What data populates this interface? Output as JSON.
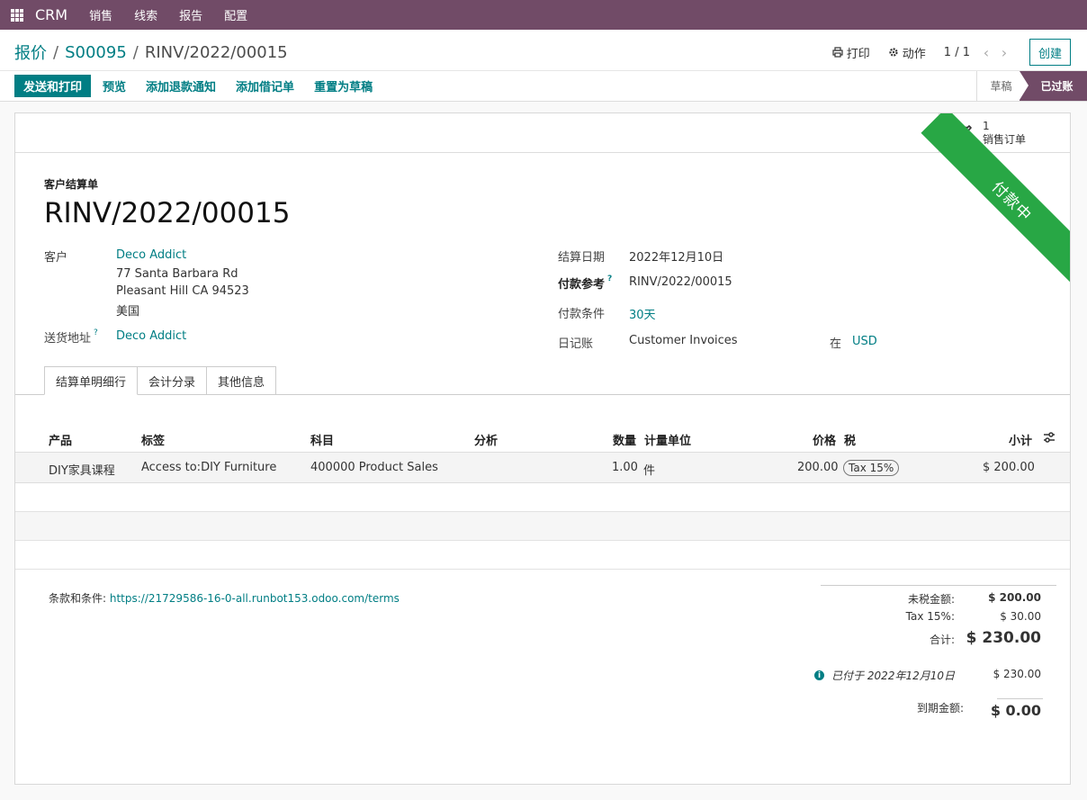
{
  "topbar": {
    "app": "CRM",
    "menu": [
      "销售",
      "线索",
      "报告",
      "配置"
    ]
  },
  "breadcrumb": {
    "root": "报价",
    "order": "S00095",
    "current": "RINV/2022/00015"
  },
  "controls": {
    "print": "打印",
    "action": "动作",
    "pager": "1 / 1",
    "create": "创建"
  },
  "actions": {
    "send_print": "发送和打印",
    "preview": "预览",
    "credit_note": "添加退款通知",
    "debit_note": "添加借记单",
    "reset_draft": "重置为草稿"
  },
  "status": {
    "draft": "草稿",
    "posted": "已过账"
  },
  "smart_button": {
    "count": "1",
    "label": "销售订单"
  },
  "ribbon": "付款中",
  "doc": {
    "type": "客户结算单",
    "name": "RINV/2022/00015"
  },
  "fields": {
    "customer_label": "客户",
    "customer": "Deco Addict",
    "address1": "77 Santa Barbara Rd",
    "address2": "Pleasant Hill CA 94523",
    "country": "美国",
    "delivery_label": "送货地址",
    "delivery": "Deco Addict",
    "help": "?",
    "date_label": "结算日期",
    "date": "2022年12月10日",
    "ref_label": "付款参考",
    "ref": "RINV/2022/00015",
    "terms_label": "付款条件",
    "terms": "30天",
    "journal_label": "日记账",
    "journal": "Customer Invoices",
    "in_label": "在",
    "currency": "USD"
  },
  "tabs": [
    "结算单明细行",
    "会计分录",
    "其他信息"
  ],
  "table": {
    "headers": {
      "product": "产品",
      "label": "标签",
      "account": "科目",
      "analytic": "分析",
      "qty": "数量",
      "uom": "计量单位",
      "price": "价格",
      "tax": "税",
      "subtotal": "小计"
    },
    "rows": [
      {
        "product": "DIY家具课程",
        "label": "Access to:DIY Furniture",
        "account": "400000 Product Sales",
        "qty": "1.00",
        "uom": "件",
        "price": "200.00",
        "tax": "Tax 15%",
        "subtotal": "$ 200.00"
      }
    ]
  },
  "footer": {
    "terms_label": "条款和条件:",
    "terms_url": "https://21729586-16-0-all.runbot153.odoo.com/terms",
    "untaxed_label": "未税金额:",
    "untaxed": "$ 200.00",
    "tax_label": "Tax 15%:",
    "tax": "$ 30.00",
    "total_label": "合计:",
    "total": "$ 230.00",
    "paid_label": "已付于 2022年12月10日",
    "paid": "$ 230.00",
    "due_label": "到期金额:",
    "due": "$ 0.00"
  }
}
